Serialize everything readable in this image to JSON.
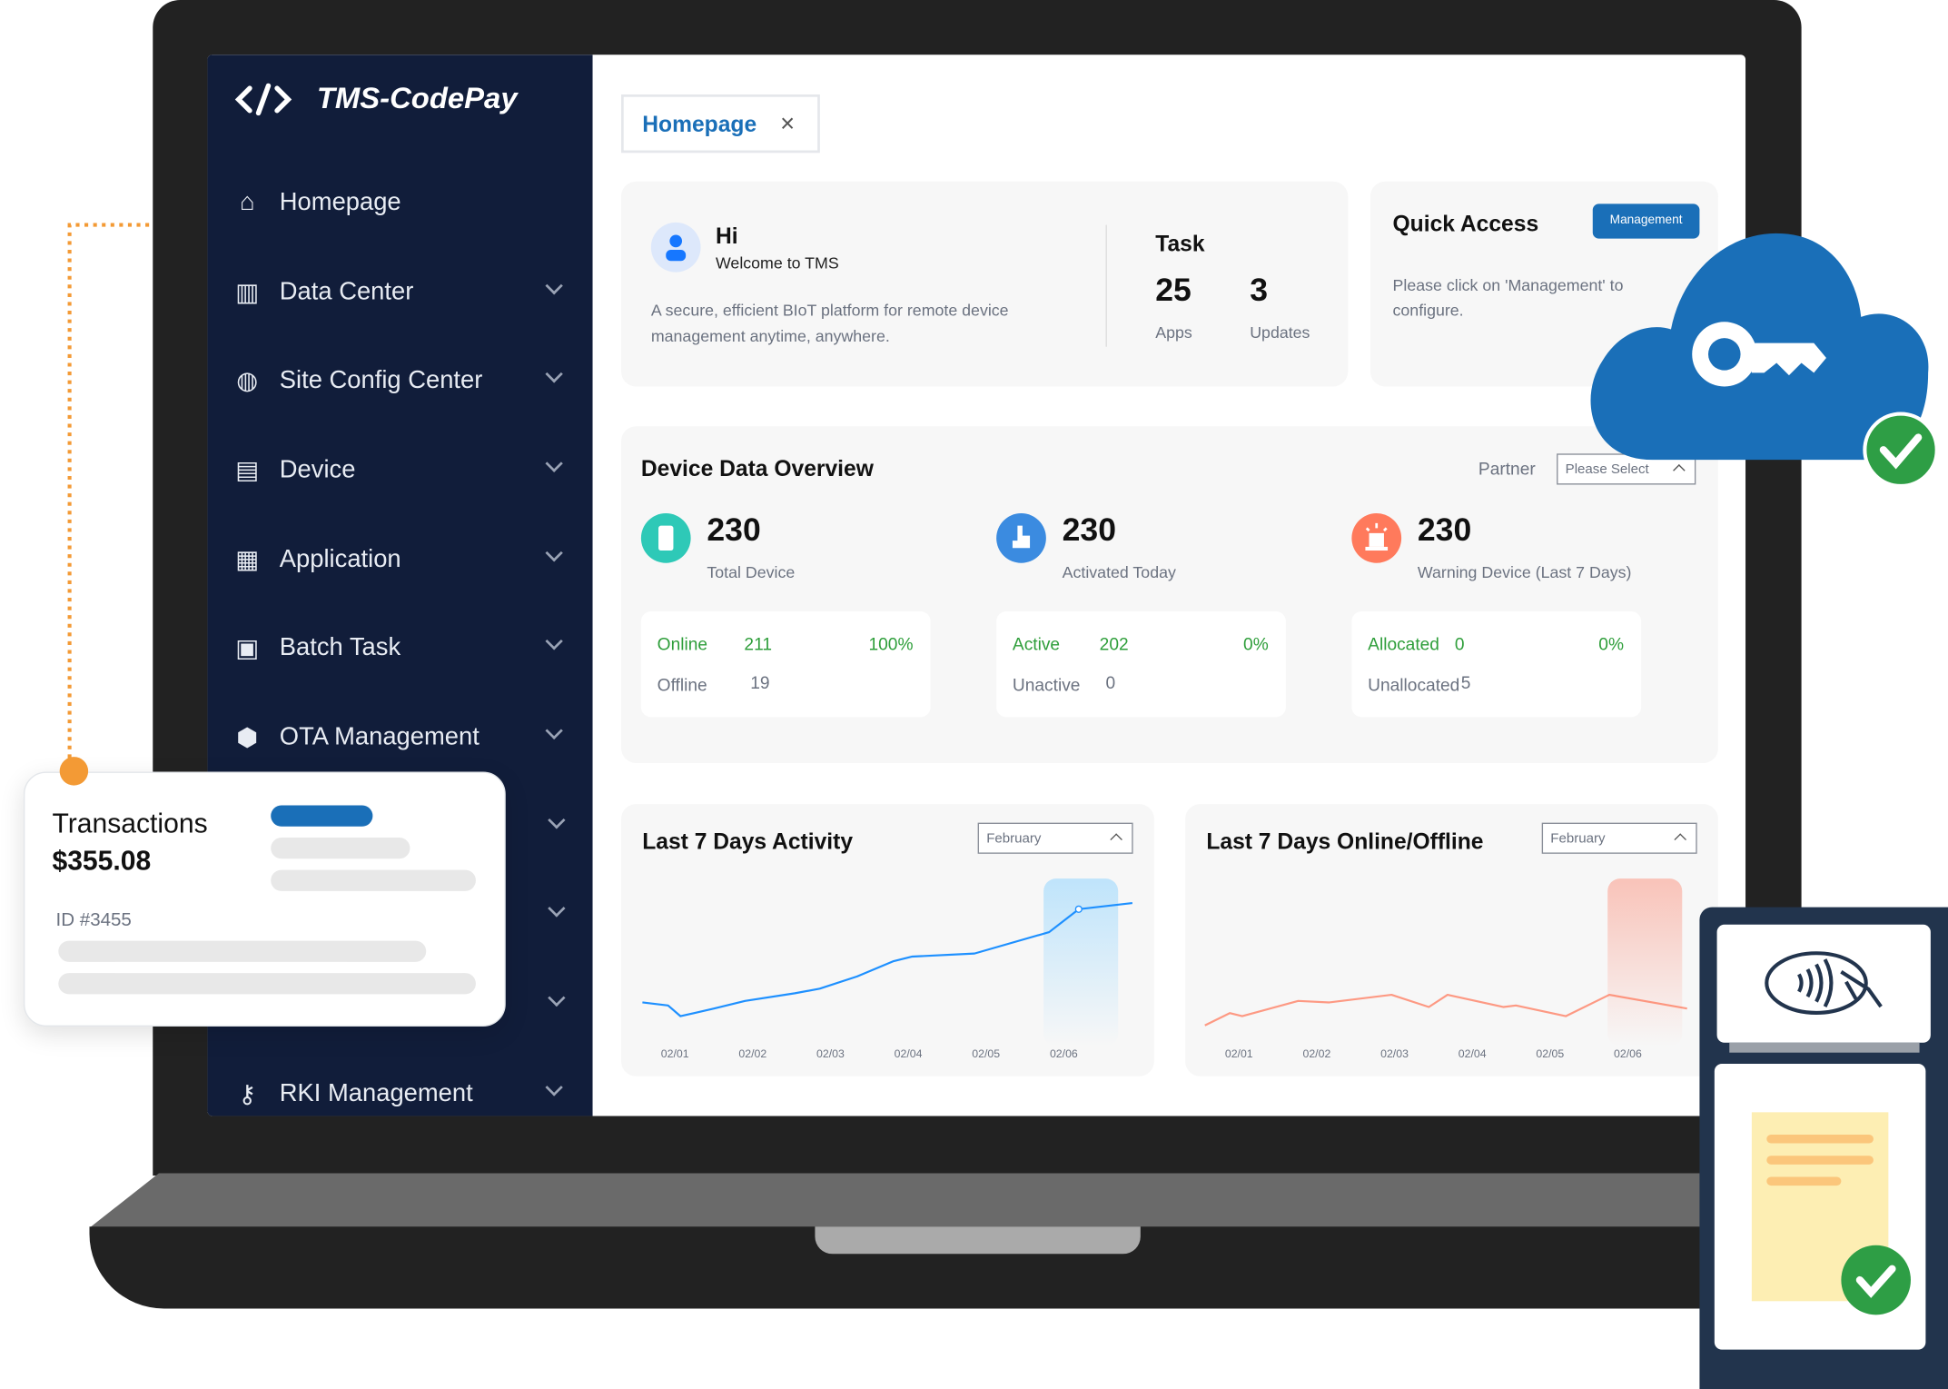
{
  "app": {
    "title": "TMS-CodePay",
    "logo_icon": "code-icon"
  },
  "sidebar": {
    "items": [
      {
        "label": "Homepage",
        "icon": "home-icon",
        "expandable": false
      },
      {
        "label": "Data Center",
        "icon": "chart-icon",
        "expandable": true
      },
      {
        "label": "Site Config Center",
        "icon": "globe-icon",
        "expandable": true
      },
      {
        "label": "Device",
        "icon": "device-icon",
        "expandable": true
      },
      {
        "label": "Application",
        "icon": "apps-icon",
        "expandable": true
      },
      {
        "label": "Batch Task",
        "icon": "batch-icon",
        "expandable": true
      },
      {
        "label": "OTA Management",
        "icon": "cube-icon",
        "expandable": true
      },
      {
        "label": "RKI Management",
        "icon": "key-icon",
        "expandable": true
      }
    ]
  },
  "tabs": [
    {
      "label": "Homepage",
      "close": "×"
    }
  ],
  "welcome": {
    "greeting": "Hi",
    "subtitle": "Welcome to TMS",
    "description_line1": "A secure, efficient BIoT platform for remote device",
    "description_line2": "management anytime, anywhere.",
    "task_title": "Task",
    "apps_count": "25",
    "apps_label": "Apps",
    "updates_count": "3",
    "updates_label": "Updates"
  },
  "quick_access": {
    "title": "Quick Access",
    "button": "Management",
    "text_line1": "Please click on 'Management' to",
    "text_line2": "configure."
  },
  "overview": {
    "title": "Device Data Overview",
    "partner_label": "Partner",
    "partner_placeholder": "Please Select",
    "stats": [
      {
        "value": "230",
        "label": "Total Device",
        "color": "#2ec9b7",
        "icon": "phone-icon",
        "rows": [
          {
            "label": "Online",
            "value": "211",
            "pct": "100%"
          },
          {
            "label": "Offline",
            "value": "19"
          }
        ]
      },
      {
        "value": "230",
        "label": "Activated Today",
        "color": "#3b8be0",
        "icon": "tap-icon",
        "rows": [
          {
            "label": "Active",
            "value": "202",
            "pct": "0%"
          },
          {
            "label": "Unactive",
            "value": "0"
          }
        ]
      },
      {
        "value": "230",
        "label": "Warning Device (Last 7 Days)",
        "color": "#ff7a5c",
        "icon": "alarm-icon",
        "rows": [
          {
            "label": "Allocated",
            "value": "0",
            "pct": "0%"
          },
          {
            "label": "Unallocated",
            "value": "5"
          }
        ]
      }
    ]
  },
  "chart_data": [
    {
      "type": "line",
      "title": "Last 7 Days Activity",
      "month_select": "February",
      "categories": [
        "02/01",
        "02/02",
        "02/03",
        "02/04",
        "02/05",
        "02/06"
      ],
      "highlight": "02/06",
      "color": "#1e90ff",
      "points": [
        [
          -0.43,
          19
        ],
        [
          -0.1,
          17
        ],
        [
          0.06,
          10
        ],
        [
          0.49,
          15
        ],
        [
          0.89,
          20
        ],
        [
          1.53,
          25
        ],
        [
          1.85,
          28
        ],
        [
          2.33,
          36
        ],
        [
          2.8,
          46
        ],
        [
          3.04,
          49
        ],
        [
          3.84,
          51
        ],
        [
          4.8,
          65
        ],
        [
          5.18,
          80
        ],
        [
          5.87,
          84
        ]
      ]
    },
    {
      "type": "line",
      "title": "Last 7 Days Online/Offline",
      "month_select": "February",
      "categories": [
        "02/01",
        "02/02",
        "02/03",
        "02/04",
        "02/05",
        "02/06"
      ],
      "highlight": "02/06",
      "color": "#ff7a5c",
      "points": [
        [
          -0.45,
          4
        ],
        [
          -0.13,
          12
        ],
        [
          0.03,
          10
        ],
        [
          0.75,
          20
        ],
        [
          1.15,
          19
        ],
        [
          1.95,
          24
        ],
        [
          2.43,
          16
        ],
        [
          2.67,
          24
        ],
        [
          3.39,
          16
        ],
        [
          3.55,
          17
        ],
        [
          4.19,
          10
        ],
        [
          4.75,
          24
        ],
        [
          5.75,
          15
        ]
      ]
    }
  ],
  "transaction_card": {
    "title": "Transactions",
    "amount": "$355.08",
    "id": "ID #3455"
  },
  "decor": {
    "cloud_icon": "cloud-key-icon",
    "terminal_icon": "contactless-payment-icon",
    "accent": "#1a6fb8",
    "success": "#2e9e45"
  }
}
